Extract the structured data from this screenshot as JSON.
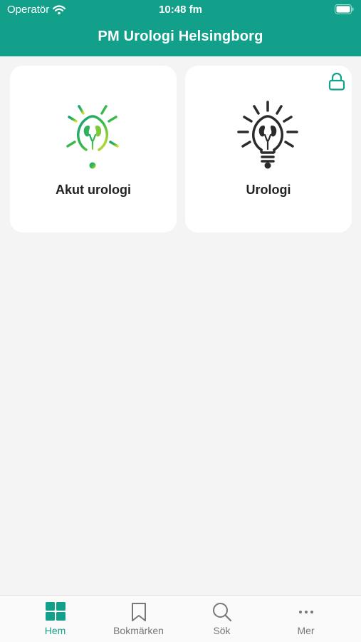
{
  "status_bar": {
    "carrier": "Operatör",
    "time": "10:48 fm"
  },
  "header": {
    "title": "PM Urologi Helsingborg"
  },
  "cards": [
    {
      "label": "Akut urologi",
      "icon": "kidney-lightbulb-icon",
      "locked": false
    },
    {
      "label": "Urologi",
      "icon": "kidney-lightbulb-icon",
      "locked": true
    }
  ],
  "tabs": [
    {
      "label": "Hem",
      "icon": "grid-icon",
      "active": true
    },
    {
      "label": "Bokmärken",
      "icon": "bookmark-icon",
      "active": false
    },
    {
      "label": "Sök",
      "icon": "search-icon",
      "active": false
    },
    {
      "label": "Mer",
      "icon": "more-icon",
      "active": false
    }
  ],
  "colors": {
    "accent": "#12a08b",
    "background": "#f4f4f4",
    "card": "#ffffff",
    "inactive": "#777777"
  }
}
